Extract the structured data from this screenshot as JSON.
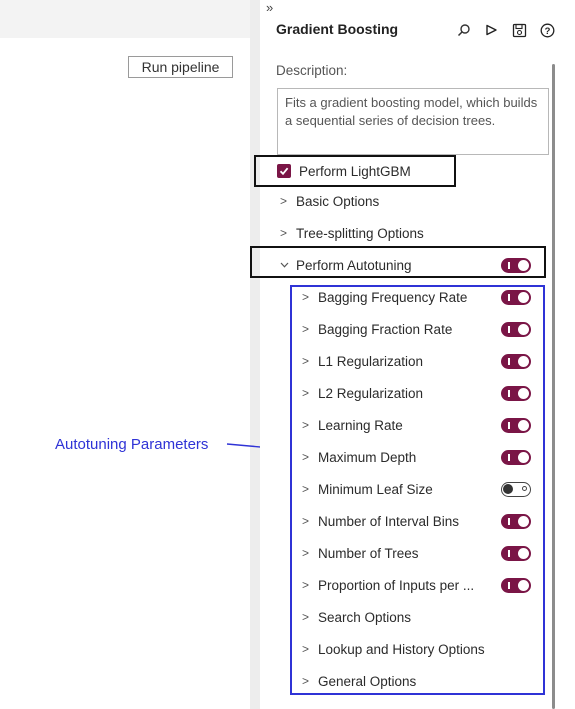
{
  "left": {
    "run_button_label": "Run pipeline",
    "annotation_label": "Autotuning Parameters"
  },
  "panel": {
    "collapse_glyph": "»",
    "title": "Gradient Boosting",
    "toolbar_icons": [
      "search-icon",
      "run-icon",
      "save-icon",
      "help-icon"
    ],
    "description_label": "Description:",
    "description_text": "Fits a gradient boosting model, which builds a sequential series of decision trees.",
    "lightgbm": {
      "label": "Perform LightGBM",
      "checked": true
    },
    "sections": [
      {
        "label": "Basic Options",
        "expanded": false
      },
      {
        "label": "Tree-splitting Options",
        "expanded": false
      }
    ],
    "autotuning": {
      "label": "Perform Autotuning",
      "enabled": true,
      "expanded": true
    },
    "params": [
      {
        "label": "Bagging Frequency Rate",
        "toggle": true
      },
      {
        "label": "Bagging Fraction Rate",
        "toggle": true
      },
      {
        "label": "L1 Regularization",
        "toggle": true
      },
      {
        "label": "L2 Regularization",
        "toggle": true
      },
      {
        "label": "Learning Rate",
        "toggle": true
      },
      {
        "label": "Maximum Depth",
        "toggle": true
      },
      {
        "label": "Minimum Leaf Size",
        "toggle": false
      },
      {
        "label": "Number of Interval Bins",
        "toggle": true
      },
      {
        "label": "Number of Trees",
        "toggle": true
      },
      {
        "label": "Proportion of Inputs per ...",
        "toggle": true
      },
      {
        "label": "Search Options",
        "toggle": null
      },
      {
        "label": "Lookup and History Options",
        "toggle": null
      },
      {
        "label": "General Options",
        "toggle": null
      }
    ]
  },
  "colors": {
    "accent": "#7a1546",
    "annotation": "#2f33d6",
    "highlight_box": "#111111"
  }
}
